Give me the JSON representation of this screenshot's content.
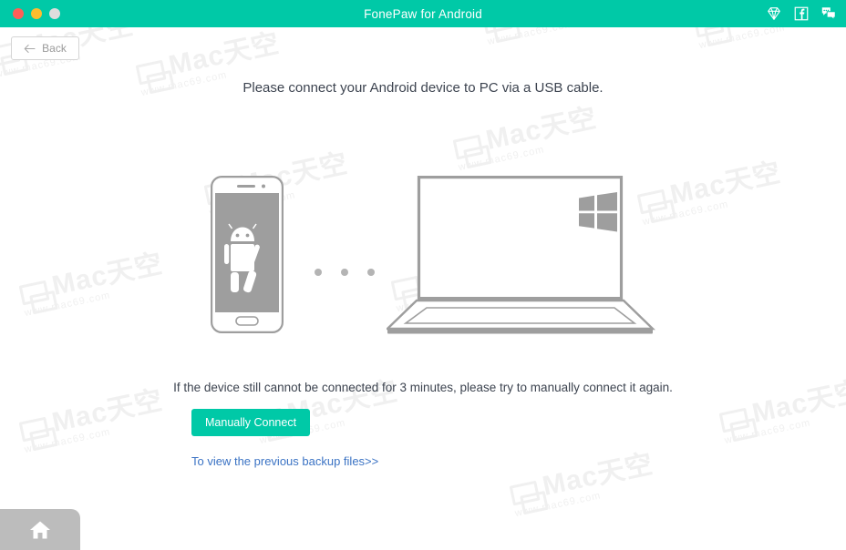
{
  "window": {
    "title": "FonePaw for Android",
    "traffic_lights": [
      {
        "name": "close",
        "color": "#ff5f57"
      },
      {
        "name": "minimize",
        "color": "#ffbd2e"
      },
      {
        "name": "zoom",
        "color": "#dddddd"
      }
    ],
    "titlebar_icons": [
      {
        "name": "diamond-icon",
        "label": "Register / Upgrade"
      },
      {
        "name": "facebook-icon",
        "label": "Facebook"
      },
      {
        "name": "feedback-icon",
        "label": "Feedback"
      }
    ]
  },
  "theme": {
    "accent": "#00c9a7",
    "link": "#3b73c4",
    "text": "#3d4450",
    "muted": "#9a9a9a",
    "illustration_grey": "#9e9e9e",
    "dot": "#b4b4b4",
    "watermark": "#f0f0f0"
  },
  "toolbar": {
    "back_label": "Back",
    "back_icon": "arrow-left-icon"
  },
  "main": {
    "headline": "Please connect your Android device to PC via a USB cable.",
    "hint": "If the device still cannot be connected for 3 minutes, please try to manually connect it again.",
    "connect_button": "Manually Connect",
    "backup_link": "To view the previous backup files>>"
  },
  "illustration": {
    "phone": {
      "name": "android-phone",
      "os_icon": "android-robot-icon"
    },
    "connection_dots": 3,
    "laptop": {
      "name": "windows-laptop",
      "os_icon": "windows-logo-icon"
    }
  },
  "footer": {
    "home_button": {
      "name": "home-button",
      "icon": "home-icon"
    }
  },
  "watermarks": {
    "main_text": "Mac天空",
    "sub_text": "www.mac69.com"
  }
}
